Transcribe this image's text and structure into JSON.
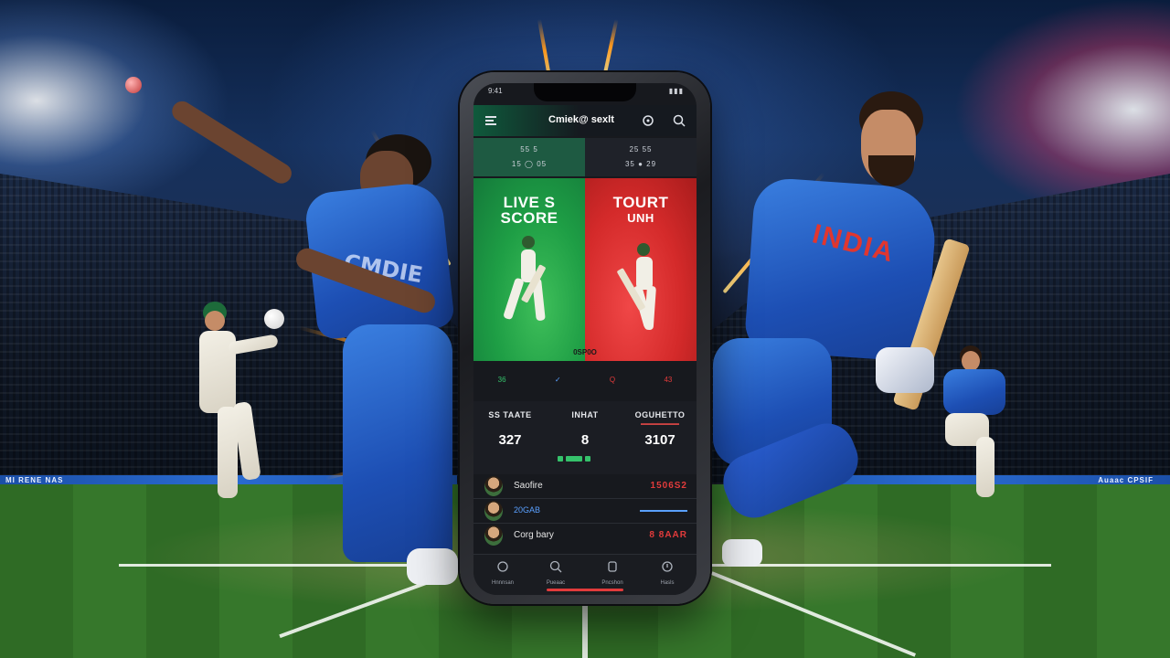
{
  "stadium": {
    "ad_left": "MI RENE NAS",
    "ad_right": "Auaac CPSIF"
  },
  "players": {
    "bowler_jersey_text": "CMDIE",
    "batter_jersey_text": "INDIA"
  },
  "app": {
    "status_time": "9:41",
    "status_icons": "▮▮▮",
    "title": "Cmiek@ sexlt",
    "menu_icon": "menu-icon",
    "refresh_icon": "refresh-icon",
    "search_icon": "search-icon",
    "mini_scores": {
      "left": {
        "top": "55  5",
        "bottom": "15  ◯  05"
      },
      "right": {
        "top": "25  55",
        "bottom": "35  ●  29"
      }
    },
    "hero_left": {
      "line1": "LIVE S",
      "line2": "SCORE"
    },
    "hero_right": {
      "line1": "TOURT",
      "line2": "UNH"
    },
    "hero_tag": "0SP0O",
    "tabs": [
      "36",
      "✓",
      "Q",
      "43"
    ],
    "stats": [
      {
        "label": "SS TAATE",
        "sub": "",
        "value": "327"
      },
      {
        "label": "INHAT",
        "sub": "",
        "value": "8"
      },
      {
        "label": "OGUHETTO",
        "sub": "▬▬▬▬▬▬▬",
        "value": "3107"
      }
    ],
    "list": [
      {
        "name": "Saofire",
        "score": "1506S2"
      },
      {
        "name": "20GAB",
        "score": ""
      },
      {
        "name": "Corg bary",
        "score": "8 8AAR"
      }
    ],
    "nav": [
      {
        "icon": "home-icon",
        "label": "Hnnnsan"
      },
      {
        "icon": "search-icon",
        "label": "Pueaac"
      },
      {
        "icon": "profile-icon",
        "label": "Pncshon"
      },
      {
        "icon": "settings-icon",
        "label": "Hasls"
      }
    ],
    "colors": {
      "green": "#1e9e45",
      "red": "#d42a2a",
      "accent": "#e23b3b"
    }
  }
}
